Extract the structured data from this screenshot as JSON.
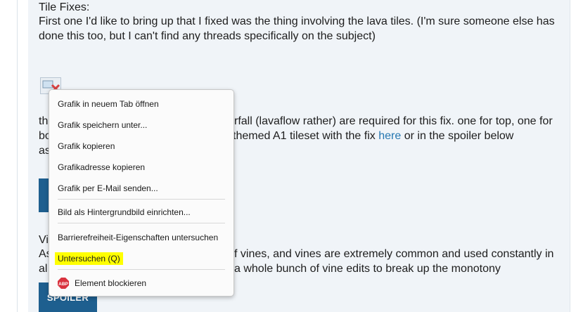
{
  "post": {
    "heading": "Tile Fixes:",
    "line1": "First one I'd like to bring up that I fixed was the thing involving the lava tiles. (I'm sure someone else has",
    "line2": "done this too, but I can't find any threads specifically on the subject)",
    "frag_th": "th",
    "frag_bo": "bo",
    "frag_as": "as",
    "frag_lava": "rfall (lavaflow rather) are required for this fix. one for top, one for",
    "frag_themed": "themed A1 tileset with the fix",
    "link_here": "here",
    "frag_spoiler_below": "or in the spoiler below",
    "frag_vi": "Vi",
    "frag_as2": "As",
    "frag_vines": "f vines, and vines are extremely common and used constantly in",
    "frag_al": "al",
    "frag_vine_edits": "a whole bunch of vine edits to break up the monotony",
    "spoiler_label": "SPOILER"
  },
  "context_menu": {
    "items": [
      {
        "label": "Grafik in neuem Tab öffnen"
      },
      {
        "label": "Grafik speichern unter..."
      },
      {
        "label": "Grafik kopieren"
      },
      {
        "label": "Grafikadresse kopieren"
      },
      {
        "label": "Grafik per E-Mail senden..."
      },
      {
        "label": "Bild als Hintergrundbild einrichten..."
      },
      {
        "label": "Barrierefreiheit-Eigenschaften untersuchen"
      },
      {
        "label": "Untersuchen (Q)"
      },
      {
        "label": "Element blockieren"
      }
    ],
    "highlight_color": "#ffff00",
    "abp_icon_text": "ABP",
    "abp_color": "#d9333f"
  }
}
